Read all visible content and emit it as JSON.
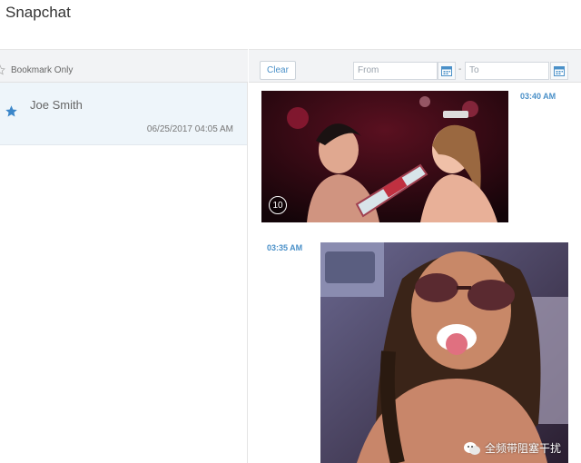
{
  "app": {
    "title": "Snapchat"
  },
  "left": {
    "bookmark_label": "Bookmark Only",
    "contacts": [
      {
        "name": "Joe Smith",
        "time": "06/25/2017 04:05 AM",
        "bookmarked": true
      }
    ]
  },
  "right": {
    "clear_label": "Clear",
    "from_placeholder": "From",
    "to_placeholder": "To",
    "date_separator": "-",
    "messages": [
      {
        "time": "03:40 AM",
        "timer": "10"
      },
      {
        "time": "03:35 AM"
      }
    ],
    "watermark": "全频带阻塞干扰"
  },
  "colors": {
    "accent": "#4a90c8",
    "star": "#3b86c9",
    "selected_row": "#eef5fa"
  }
}
